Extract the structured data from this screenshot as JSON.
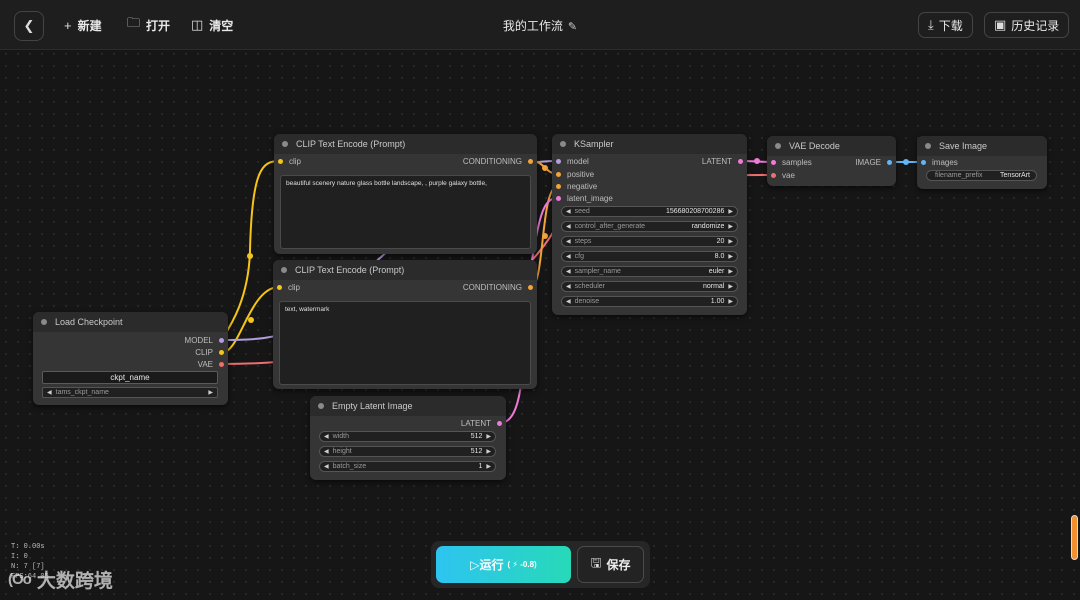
{
  "header": {
    "back_icon": "chevron-left-icon",
    "new_label": "新建",
    "open_label": "打开",
    "clear_label": "清空",
    "title": "我的工作流",
    "download_label": "下载",
    "history_label": "历史记录"
  },
  "nodes": {
    "load_checkpoint": {
      "title": "Load Checkpoint",
      "outputs": [
        "MODEL",
        "CLIP",
        "VAE"
      ],
      "ckpt_name": "ckpt_name",
      "tams_label": "tams_ckpt_name"
    },
    "clip_pos": {
      "title": "CLIP Text Encode (Prompt)",
      "input": "clip",
      "output": "CONDITIONING",
      "text": "beautiful scenery nature glass bottle landscape, , purple galaxy bottle,"
    },
    "clip_neg": {
      "title": "CLIP Text Encode (Prompt)",
      "input": "clip",
      "output": "CONDITIONING",
      "text": "text, watermark"
    },
    "ksampler": {
      "title": "KSampler",
      "inputs": [
        "model",
        "positive",
        "negative",
        "latent_image"
      ],
      "output": "LATENT",
      "widgets": [
        {
          "label": "seed",
          "value": "156680208700286"
        },
        {
          "label": "control_after_generate",
          "value": "randomize"
        },
        {
          "label": "steps",
          "value": "20"
        },
        {
          "label": "cfg",
          "value": "8.0"
        },
        {
          "label": "sampler_name",
          "value": "euler"
        },
        {
          "label": "scheduler",
          "value": "normal"
        },
        {
          "label": "denoise",
          "value": "1.00"
        }
      ]
    },
    "vae_decode": {
      "title": "VAE Decode",
      "inputs": [
        "samples",
        "vae"
      ],
      "output": "IMAGE"
    },
    "save_image": {
      "title": "Save Image",
      "input": "images",
      "prefix_label": "filename_prefix",
      "prefix_value": "TensorArt"
    },
    "empty_latent": {
      "title": "Empty Latent Image",
      "output": "LATENT",
      "widgets": [
        {
          "label": "width",
          "value": "512"
        },
        {
          "label": "height",
          "value": "512"
        },
        {
          "label": "batch_size",
          "value": "1"
        }
      ]
    }
  },
  "actions": {
    "run_label": "▷运行",
    "run_cost": "( ⚡ -0.8)",
    "save_label": "保存"
  },
  "stats": [
    "T: 0.00s",
    "I: 0",
    "N: 7 [7]",
    "FPS:64.05"
  ],
  "watermark": {
    "logo": "(Oo",
    "text": "大数跨境"
  },
  "colors": {
    "model": "#b39ddb",
    "clip": "#f5c518",
    "vae": "#ef6f6f",
    "conditioning": "#f2a33a",
    "latent": "#f07ad9",
    "image": "#64b5f6",
    "run_gradient_start": "#2ec4f0",
    "run_gradient_end": "#27d9b8"
  }
}
